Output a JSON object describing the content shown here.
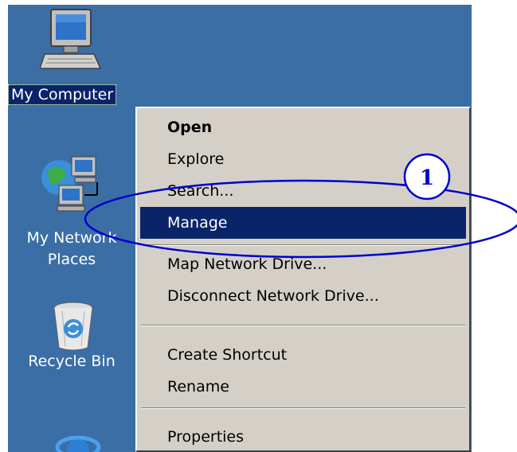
{
  "desktop": {
    "background": "#3a6ea5",
    "icons": [
      {
        "label": "My Computer",
        "icon": "my-computer-icon",
        "selected": true
      },
      {
        "label_lines": [
          "My Network",
          "Places"
        ],
        "icon": "network-places-icon"
      },
      {
        "label": "Recycle Bin",
        "icon": "recycle-bin-icon"
      },
      {
        "icon": "internet-explorer-icon"
      }
    ]
  },
  "context_menu": {
    "items": [
      {
        "label": "Open",
        "default": true
      },
      {
        "label": "Explore"
      },
      {
        "label": "Search..."
      },
      {
        "label": "Manage",
        "highlighted": true
      },
      {
        "label": "Map Network Drive..."
      },
      {
        "label": "Disconnect Network Drive..."
      },
      {
        "label": "Create Shortcut"
      },
      {
        "label": "Rename"
      },
      {
        "label": "Properties"
      }
    ],
    "highlight_color": "#0a246a"
  },
  "annotation": {
    "step_number": "1",
    "color": "#0000cc"
  }
}
